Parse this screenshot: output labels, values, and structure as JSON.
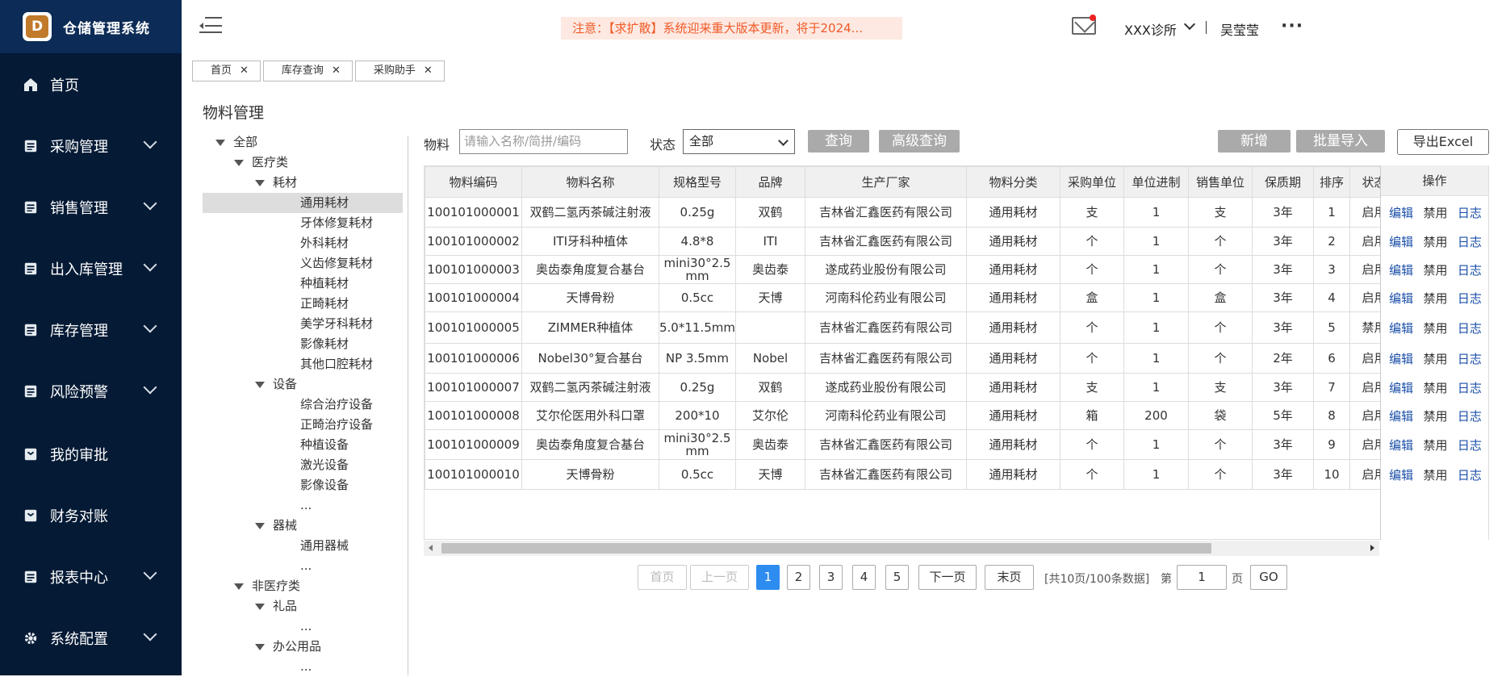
{
  "app": {
    "title": "仓储管理系统",
    "logo_letter": "D"
  },
  "sidebar": {
    "items": [
      {
        "label": "首页",
        "icon": "home-icon",
        "has_chevron": false
      },
      {
        "label": "采购管理",
        "icon": "list-icon",
        "has_chevron": true
      },
      {
        "label": "销售管理",
        "icon": "list-icon",
        "has_chevron": true
      },
      {
        "label": "出入库管理",
        "icon": "list-icon",
        "has_chevron": true
      },
      {
        "label": "库存管理",
        "icon": "list-icon",
        "has_chevron": true
      },
      {
        "label": "风险预警",
        "icon": "list-icon",
        "has_chevron": true
      },
      {
        "label": "我的审批",
        "icon": "check-icon",
        "has_chevron": false
      },
      {
        "label": "财务对账",
        "icon": "check-icon",
        "has_chevron": false
      },
      {
        "label": "报表中心",
        "icon": "list-icon",
        "has_chevron": true
      },
      {
        "label": "系统配置",
        "icon": "gear-icon",
        "has_chevron": true
      }
    ]
  },
  "header": {
    "notice": "注意：【求扩散】系统迎来重大版本更新，将于2024...",
    "clinic": "XXX诊所",
    "user": "吴莹莹",
    "more": "···"
  },
  "tabs": [
    {
      "label": "首页"
    },
    {
      "label": "库存查询"
    },
    {
      "label": "采购助手"
    }
  ],
  "page_title": "物料管理",
  "tree": {
    "all": "全部",
    "medical": "医疗类",
    "consumables": "耗材",
    "consumable_items": [
      "通用耗材",
      "牙体修复耗材",
      "外科耗材",
      "义齿修复耗材",
      "种植耗材",
      "正畸耗材",
      "美学牙科耗材",
      "影像耗材",
      "其他口腔耗材"
    ],
    "equipment": "设备",
    "equipment_items": [
      "综合治疗设备",
      "正畸治疗设备",
      "种植设备",
      "激光设备",
      "影像设备"
    ],
    "ellipsis": "...",
    "instruments": "器械",
    "instrument_items": [
      "通用器械"
    ],
    "nonmedical": "非医疗类",
    "gifts": "礼品",
    "office": "办公用品"
  },
  "filter": {
    "material_label": "物料",
    "material_placeholder": "请输入名称/简拼/编码",
    "status_label": "状态",
    "status_value": "全部",
    "query": "查询",
    "advanced_query": "高级查询",
    "add": "新增",
    "batch_import": "批量导入",
    "export": "导出Excel"
  },
  "table": {
    "headers": [
      "物料编码",
      "物料名称",
      "规格型号",
      "品牌",
      "生产厂家",
      "物料分类",
      "采购单位",
      "单位进制",
      "销售单位",
      "保质期",
      "排序",
      "状态"
    ],
    "ops_header": "操作",
    "ops": {
      "edit": "编辑",
      "disable": "禁用",
      "log": "日志"
    },
    "rows": [
      [
        "100101000001",
        "双鹤二氢丙茶碱注射液",
        "0.25g",
        "双鹤",
        "吉林省汇鑫医药有限公司",
        "通用耗材",
        "支",
        "1",
        "支",
        "3年",
        "1",
        "启用"
      ],
      [
        "100101000002",
        "ITI牙科种植体",
        "4.8*8",
        "ITI",
        "吉林省汇鑫医药有限公司",
        "通用耗材",
        "个",
        "1",
        "个",
        "3年",
        "2",
        "启用"
      ],
      [
        "100101000003",
        "奥齿泰角度复合基台",
        "mini30°2.5 mm",
        "奥齿泰",
        "遂成药业股份有限公司",
        "通用耗材",
        "个",
        "1",
        "个",
        "3年",
        "3",
        "启用"
      ],
      [
        "100101000004",
        "天博骨粉",
        "0.5cc",
        "天博",
        "河南科伦药业有限公司",
        "通用耗材",
        "盒",
        "1",
        "盒",
        "3年",
        "4",
        "启用"
      ],
      [
        "100101000005",
        "ZIMMER种植体",
        "5.0*11.5mm",
        "",
        "吉林省汇鑫医药有限公司",
        "通用耗材",
        "个",
        "1",
        "个",
        "3年",
        "5",
        "禁用"
      ],
      [
        "100101000006",
        "Nobel30°复合基台",
        "NP 3.5mm",
        "Nobel",
        "吉林省汇鑫医药有限公司",
        "通用耗材",
        "个",
        "1",
        "个",
        "2年",
        "6",
        "启用"
      ],
      [
        "100101000007",
        "双鹤二氢丙茶碱注射液",
        "0.25g",
        "双鹤",
        "遂成药业股份有限公司",
        "通用耗材",
        "支",
        "1",
        "支",
        "3年",
        "7",
        "启用"
      ],
      [
        "100101000008",
        "艾尔伦医用外科口罩",
        "200*10",
        "艾尔伦",
        "河南科伦药业有限公司",
        "通用耗材",
        "箱",
        "200",
        "袋",
        "5年",
        "8",
        "启用"
      ],
      [
        "100101000009",
        "奥齿泰角度复合基台",
        "mini30°2.5 mm",
        "奥齿泰",
        "吉林省汇鑫医药有限公司",
        "通用耗材",
        "个",
        "1",
        "个",
        "3年",
        "9",
        "启用"
      ],
      [
        "100101000010",
        "天博骨粉",
        "0.5cc",
        "天博",
        "吉林省汇鑫医药有限公司",
        "通用耗材",
        "个",
        "1",
        "个",
        "3年",
        "10",
        "启用"
      ]
    ]
  },
  "pagination": {
    "first": "首页",
    "prev": "上一页",
    "pages": [
      "1",
      "2",
      "3",
      "4",
      "5"
    ],
    "current": "1",
    "next": "下一页",
    "last": "末页",
    "summary": "[共10页/100条数据]",
    "goto_prefix": "第",
    "goto_value": "1",
    "goto_suffix": "页",
    "go": "GO"
  }
}
